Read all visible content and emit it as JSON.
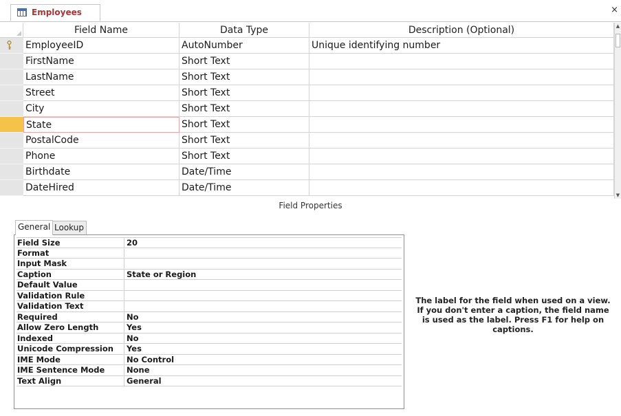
{
  "tab": {
    "title": "Employees",
    "icon": "table-icon",
    "close": "×"
  },
  "grid": {
    "headers": [
      "Field Name",
      "Data Type",
      "Description (Optional)"
    ],
    "rows": [
      {
        "name": "EmployeeID",
        "type": "AutoNumber",
        "desc": "Unique identifying number"
      },
      {
        "name": "FirstName",
        "type": "Short Text",
        "desc": ""
      },
      {
        "name": "LastName",
        "type": "Short Text",
        "desc": ""
      },
      {
        "name": "Street",
        "type": "Short Text",
        "desc": ""
      },
      {
        "name": "City",
        "type": "Short Text",
        "desc": ""
      },
      {
        "name": "State",
        "type": "Short Text",
        "desc": ""
      },
      {
        "name": "PostalCode",
        "type": "Short Text",
        "desc": ""
      },
      {
        "name": "Phone",
        "type": "Short Text",
        "desc": ""
      },
      {
        "name": "Birthdate",
        "type": "Date/Time",
        "desc": ""
      },
      {
        "name": "DateHired",
        "type": "Date/Time",
        "desc": ""
      }
    ]
  },
  "field_properties": {
    "title": "Field Properties",
    "tabs": [
      "General",
      "Lookup"
    ],
    "props": [
      {
        "label": "Field Size",
        "value": "20"
      },
      {
        "label": "Format",
        "value": ""
      },
      {
        "label": "Input Mask",
        "value": ""
      },
      {
        "label": "Caption",
        "value": "State or Region"
      },
      {
        "label": "Default Value",
        "value": ""
      },
      {
        "label": "Validation Rule",
        "value": ""
      },
      {
        "label": "Validation Text",
        "value": ""
      },
      {
        "label": "Required",
        "value": "No"
      },
      {
        "label": "Allow Zero Length",
        "value": "Yes"
      },
      {
        "label": "Indexed",
        "value": "No"
      },
      {
        "label": "Unicode Compression",
        "value": "Yes"
      },
      {
        "label": "IME Mode",
        "value": "No Control"
      },
      {
        "label": "IME Sentence Mode",
        "value": "None"
      },
      {
        "label": "Text Align",
        "value": "General"
      }
    ],
    "help": "The label for the field when used on a view. If you don't enter a caption, the field name is used as the label. Press F1 for help on captions."
  },
  "colors": {
    "tab_text": "#a4373a",
    "current_row": "#f5c24a",
    "key": "#c9a227"
  }
}
